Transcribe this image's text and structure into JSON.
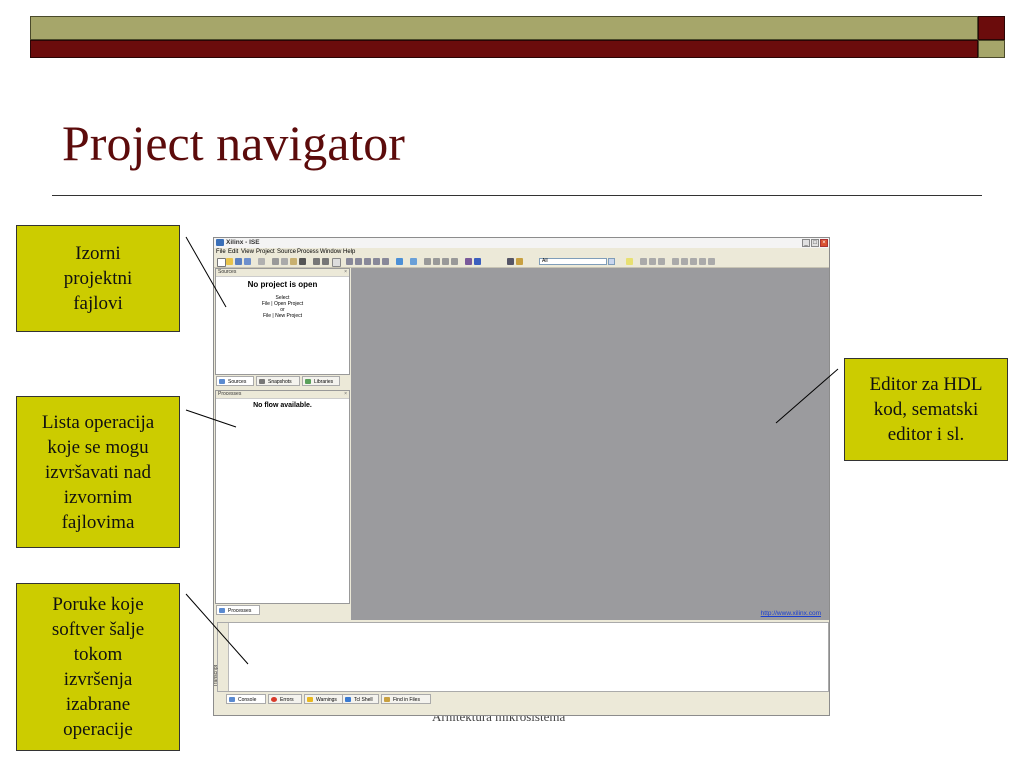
{
  "slide": {
    "title": "Project navigator",
    "footer": "Arhitektura mikrosistema"
  },
  "colors": {
    "title": "#5c0b0b",
    "header_olive": "#a6a66a",
    "header_red": "#6b0c0c",
    "callout_fill": "#cccc00",
    "editor_bg": "#9b9b9e"
  },
  "callouts": {
    "sources": "Izorni\nprojektni\nfajlovi",
    "processes": "Lista operacija\nkoje se mogu\nizvršavati nad\nizvornim\nfajlovima",
    "messages": "Poruke koje\nsoftver šalje\ntokom\nizvršenja\nizabrane\noperacije",
    "editor": "Editor za HDL\nkod, sematski\neditor i sl."
  },
  "app": {
    "title": "Xilinx - ISE",
    "menu": [
      "File",
      "Edit",
      "View",
      "Project",
      "Source",
      "Process",
      "Window",
      "Help"
    ],
    "toolbar_combo": "All",
    "sources_panel": {
      "header": "Sources",
      "heading": "No project is open",
      "line1": "Select",
      "line2": "File | Open Project",
      "line3": "or",
      "line4": "File | New Project"
    },
    "sources_tabs": [
      "Sources",
      "Snapshots",
      "Libraries"
    ],
    "processes_panel": {
      "header": "Processes",
      "message": "No flow available."
    },
    "processes_tab": "Processes",
    "editor_link": "http://www.xilinx.com",
    "transcript_label": "Transcript",
    "console_tabs": [
      "Console",
      "Errors",
      "Warnings",
      "Tcl Shell",
      "Find in Files"
    ]
  }
}
